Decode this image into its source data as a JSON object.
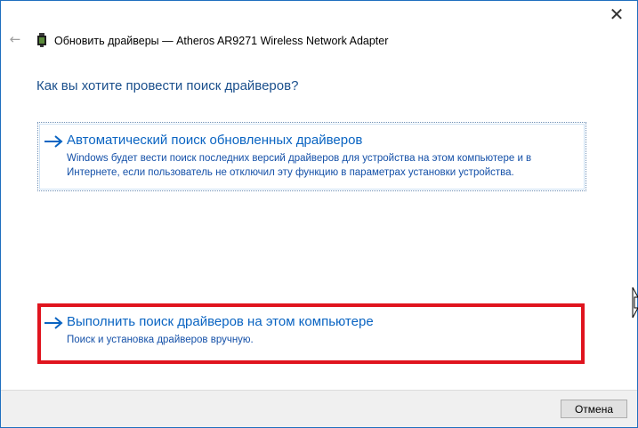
{
  "window": {
    "title": "Обновить драйверы — Atheros AR9271 Wireless Network Adapter",
    "close_glyph": "✕",
    "back_glyph": "←"
  },
  "icons": {
    "back": "back-arrow-icon",
    "device": "network-adapter-icon",
    "close": "close-icon",
    "option_arrow": "right-arrow-icon",
    "cursor": "resize-cursor-icon"
  },
  "main_instruction": "Как вы хотите провести поиск драйверов?",
  "options": [
    {
      "title": "Автоматический поиск обновленных драйверов",
      "description": "Windows будет вести поиск последних версий драйверов для устройства на этом компьютере и в Интернете, если пользователь не отключил эту функцию в параметрах установки устройства."
    },
    {
      "title": "Выполнить поиск драйверов на этом компьютере",
      "description": "Поиск и установка драйверов вручную."
    }
  ],
  "footer": {
    "cancel_label": "Отмена"
  },
  "colors": {
    "accent_link": "#0a64c2",
    "instruction": "#1a4f8c",
    "highlight_frame": "#e0141e",
    "window_border": "#1f6fbf"
  }
}
